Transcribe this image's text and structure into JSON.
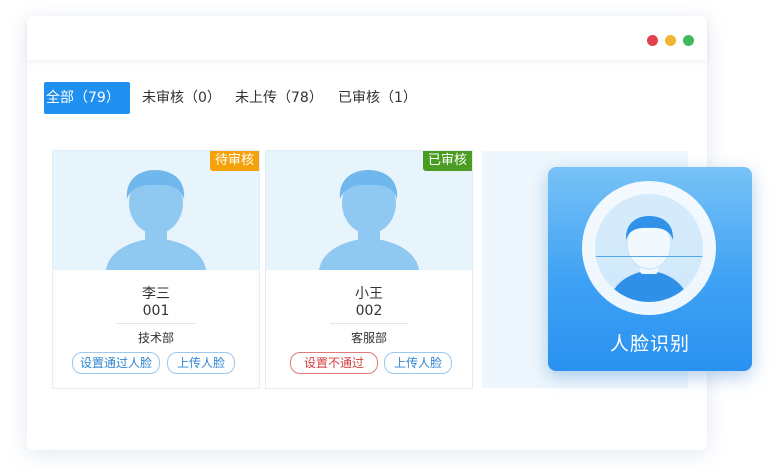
{
  "window": {
    "controls": [
      {
        "name": "close",
        "color": "#e2424f"
      },
      {
        "name": "minimize",
        "color": "#f1b430"
      },
      {
        "name": "maximize",
        "color": "#3fb75c"
      }
    ]
  },
  "tabs": [
    {
      "label": "全部（79）",
      "active": true
    },
    {
      "label": "未审核（0）",
      "active": false
    },
    {
      "label": "未上传（78）",
      "active": false
    },
    {
      "label": "已审核（1）",
      "active": false
    }
  ],
  "cards": [
    {
      "status": "待审核",
      "status_color": "#f5a20a",
      "name": "李三",
      "code": "001",
      "department": "技术部",
      "actions": [
        {
          "label": "设置通过人脸",
          "style": "blue"
        },
        {
          "label": "上传人脸",
          "style": "blue"
        }
      ]
    },
    {
      "status": "已审核",
      "status_color": "#4a9d22",
      "name": "小王",
      "code": "002",
      "department": "客服部",
      "actions": [
        {
          "label": "设置不通过",
          "style": "red"
        },
        {
          "label": "上传人脸",
          "style": "blue"
        }
      ]
    }
  ],
  "face_recognition": {
    "label": "人脸识别",
    "icon": "face-scan-icon"
  },
  "colors": {
    "accent": "#1f8ff0",
    "pending": "#f5a20a",
    "approved": "#4a9d22",
    "reject": "#d43f3f"
  }
}
